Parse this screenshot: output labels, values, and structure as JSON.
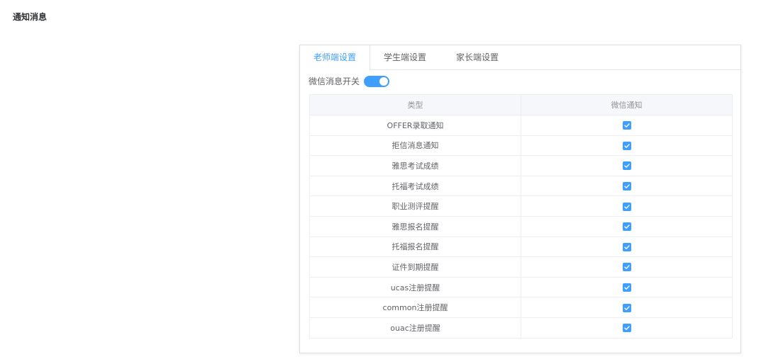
{
  "page": {
    "title": "通知消息"
  },
  "tabs": [
    {
      "label": "老师端设置",
      "active": true
    },
    {
      "label": "学生端设置",
      "active": false
    },
    {
      "label": "家长端设置",
      "active": false
    }
  ],
  "wechat_switch": {
    "label": "微信消息开关",
    "on": true
  },
  "table": {
    "headers": [
      "类型",
      "微信通知"
    ],
    "rows": [
      {
        "type": "OFFER录取通知",
        "wechat": true
      },
      {
        "type": "拒信消息通知",
        "wechat": true
      },
      {
        "type": "雅思考试成绩",
        "wechat": true
      },
      {
        "type": "托福考试成绩",
        "wechat": true
      },
      {
        "type": "职业测评提醒",
        "wechat": true
      },
      {
        "type": "雅思报名提醒",
        "wechat": true
      },
      {
        "type": "托福报名提醒",
        "wechat": true
      },
      {
        "type": "证件到期提醒",
        "wechat": true
      },
      {
        "type": "ucas注册提醒",
        "wechat": true
      },
      {
        "type": "common注册提醒",
        "wechat": true
      },
      {
        "type": "ouac注册提醒",
        "wechat": true
      }
    ]
  },
  "colors": {
    "accent": "#409eff",
    "border": "#ebeef5",
    "header_bg": "#f5f7fa"
  },
  "icons": {
    "checkbox": "check-icon"
  }
}
